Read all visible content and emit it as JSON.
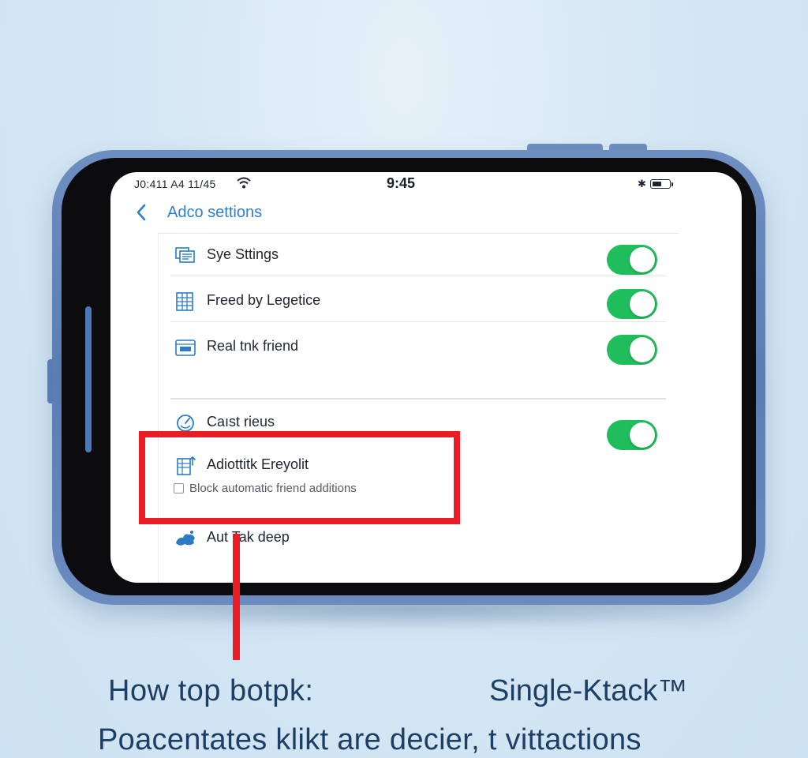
{
  "status_bar": {
    "left_text": "J0:411 A4 11/45",
    "time": "9:45",
    "wifi_icon": "wifi-icon",
    "bluetooth_icon": "bluetooth-icon",
    "battery_level": 0.6
  },
  "nav": {
    "back_icon": "chevron-left-icon",
    "title": "Adco settions"
  },
  "settings": {
    "rows": [
      {
        "label": "Sye Sttings",
        "icon": "stacked-screens-icon",
        "toggle_on": true
      },
      {
        "label": "Freed by Legetice",
        "icon": "grid-document-icon",
        "toggle_on": true
      },
      {
        "label": "Real tnk friend",
        "icon": "id-card-icon",
        "toggle_on": true
      },
      {
        "label": "Caıst rieus",
        "icon": "clock-icon",
        "toggle_on": true
      },
      {
        "label": "Adiottitk Ereyolit",
        "icon": "document-upload-icon"
      },
      {
        "label": "Aut Tak deep",
        "icon": "brush-stroke-icon"
      }
    ],
    "checkbox": {
      "label": "Block automatic friend additions",
      "checked": false
    }
  },
  "annotation": {
    "color": "#ea1c24"
  },
  "caption": {
    "line1_left": "How top botpk:",
    "line1_right": "Single-Ktack™",
    "line2": "Poacentates klikt are decier, t vittactions"
  },
  "colors": {
    "accent": "#2f7fcf",
    "toggle_on": "#20bd5c",
    "frame": "#6f8ec0",
    "caption": "#1f3e66"
  }
}
